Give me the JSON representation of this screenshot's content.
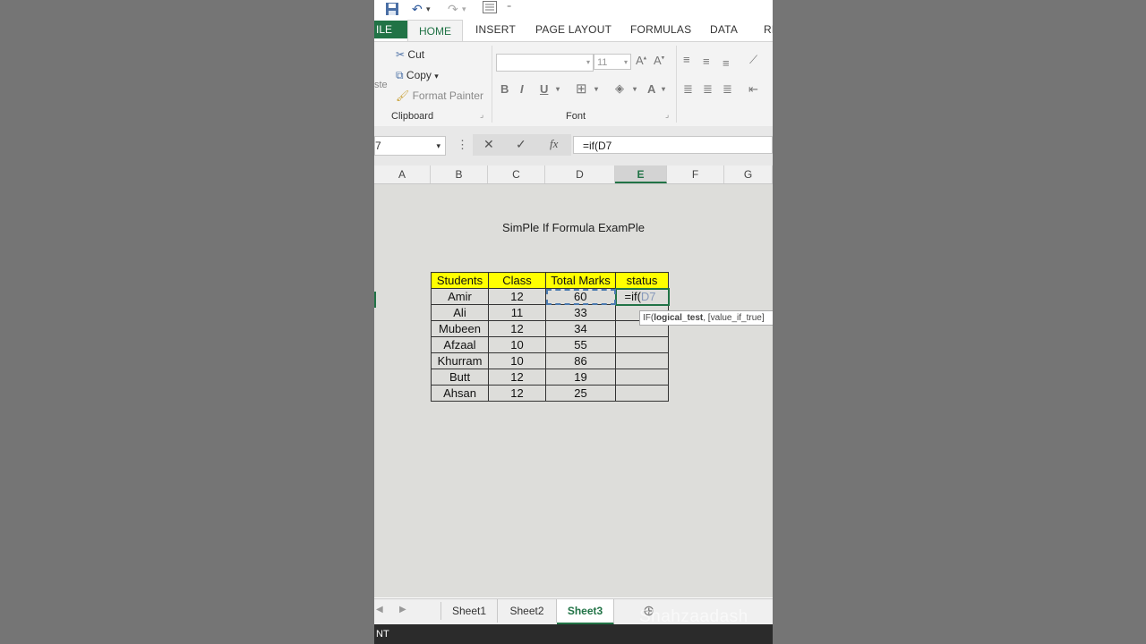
{
  "ribbon_tabs": {
    "file": "ILE",
    "home": "HOME",
    "insert": "INSERT",
    "page_layout": "PAGE LAYOUT",
    "formulas": "FORMULAS",
    "data": "DATA",
    "review": "RE"
  },
  "clipboard": {
    "paste": "ste",
    "cut": "Cut",
    "copy": "Copy",
    "format_painter": "Format Painter",
    "group_label": "Clipboard"
  },
  "font": {
    "size": "11",
    "bold": "B",
    "italic": "I",
    "underline": "U",
    "font_color": "A",
    "group_label": "Font"
  },
  "formula_bar": {
    "name_box": "7",
    "cancel": "✕",
    "enter": "✓",
    "fx": "fx",
    "formula": "=if(D7"
  },
  "columns": [
    "A",
    "B",
    "C",
    "D",
    "E",
    "F",
    "G"
  ],
  "sheet": {
    "title": "SimPle If Formula ExamPle",
    "headers": [
      "Students",
      "Class",
      "Total Marks",
      "status"
    ],
    "rows": [
      {
        "student": "Amir",
        "class": "12",
        "marks": "60"
      },
      {
        "student": "Ali",
        "class": "11",
        "marks": "33"
      },
      {
        "student": "Mubeen",
        "class": "12",
        "marks": "34"
      },
      {
        "student": "Afzaal",
        "class": "10",
        "marks": "55"
      },
      {
        "student": "Khurram",
        "class": "10",
        "marks": "86"
      },
      {
        "student": "Butt",
        "class": "12",
        "marks": "19"
      },
      {
        "student": "Ahsan",
        "class": "12",
        "marks": "25"
      }
    ],
    "editing_prefix": "=if(",
    "editing_ref": "D7",
    "tooltip_fn": "IF(",
    "tooltip_arg1": "logical_test",
    "tooltip_rest": ", [value_if_true]"
  },
  "sheet_tabs": [
    "Sheet1",
    "Sheet2",
    "Sheet3"
  ],
  "status_text": "NT",
  "watermark": "Shahzaadash",
  "colors": {
    "accent": "#217346",
    "header_fill": "#ffff00"
  }
}
